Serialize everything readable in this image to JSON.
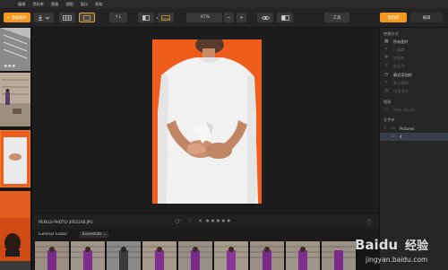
{
  "menubar": {
    "items": [
      "编辑",
      "资料库",
      "图像",
      "视图",
      "窗口",
      "帮助"
    ]
  },
  "toolbar": {
    "add_photos": "+ 添加照片",
    "export_icon": "export-icon",
    "sort_label": "↑↓",
    "zoom_label": "67%",
    "zoom_minus": "−",
    "zoom_plus": "+",
    "tools_label": "工具",
    "library_tab": "资料库",
    "edit_tab": "编辑"
  },
  "info": {
    "filename": "PEXELS-PHOTO-3952248.JPG",
    "rating_icons": [
      "heart-icon",
      "reject-icon",
      "star-icon"
    ],
    "stars": "★★★★★",
    "info_icon": "info-icon"
  },
  "looks": {
    "label": "Luminar Looks:",
    "selected": "Essentials ⌄"
  },
  "right_panel": {
    "quick_access_header": "快捷方式",
    "quick_access_items": [
      {
        "icon": "grid-icon",
        "label": "所有图片",
        "enabled": true
      },
      {
        "icon": "wand-icon",
        "label": "已编辑",
        "enabled": false
      },
      {
        "icon": "heart-icon",
        "label": "收藏夹",
        "enabled": false
      },
      {
        "icon": "reject-icon",
        "label": "被拒绝",
        "enabled": false
      },
      {
        "icon": "clock-icon",
        "label": "最近添加的",
        "enabled": true
      },
      {
        "icon": "edit-icon",
        "label": "最近编辑",
        "enabled": false
      },
      {
        "icon": "trash-icon",
        "label": "快速清除",
        "enabled": false
      }
    ],
    "albums_header": "相册",
    "new_album": "New Album",
    "folders_header": "文件夹",
    "folders": [
      {
        "label": "Pictures",
        "expanded": false
      },
      {
        "label": "4",
        "expanded": false,
        "selected": true
      }
    ]
  },
  "watermark": {
    "brand": "Baidu",
    "suffix": "经验",
    "url": "jingyan.baidu.com"
  },
  "colors": {
    "accent": "#f29a1f",
    "photo_bg": "#ef5d1d",
    "panel": "#262626",
    "selected_row": "#3a3f47"
  }
}
